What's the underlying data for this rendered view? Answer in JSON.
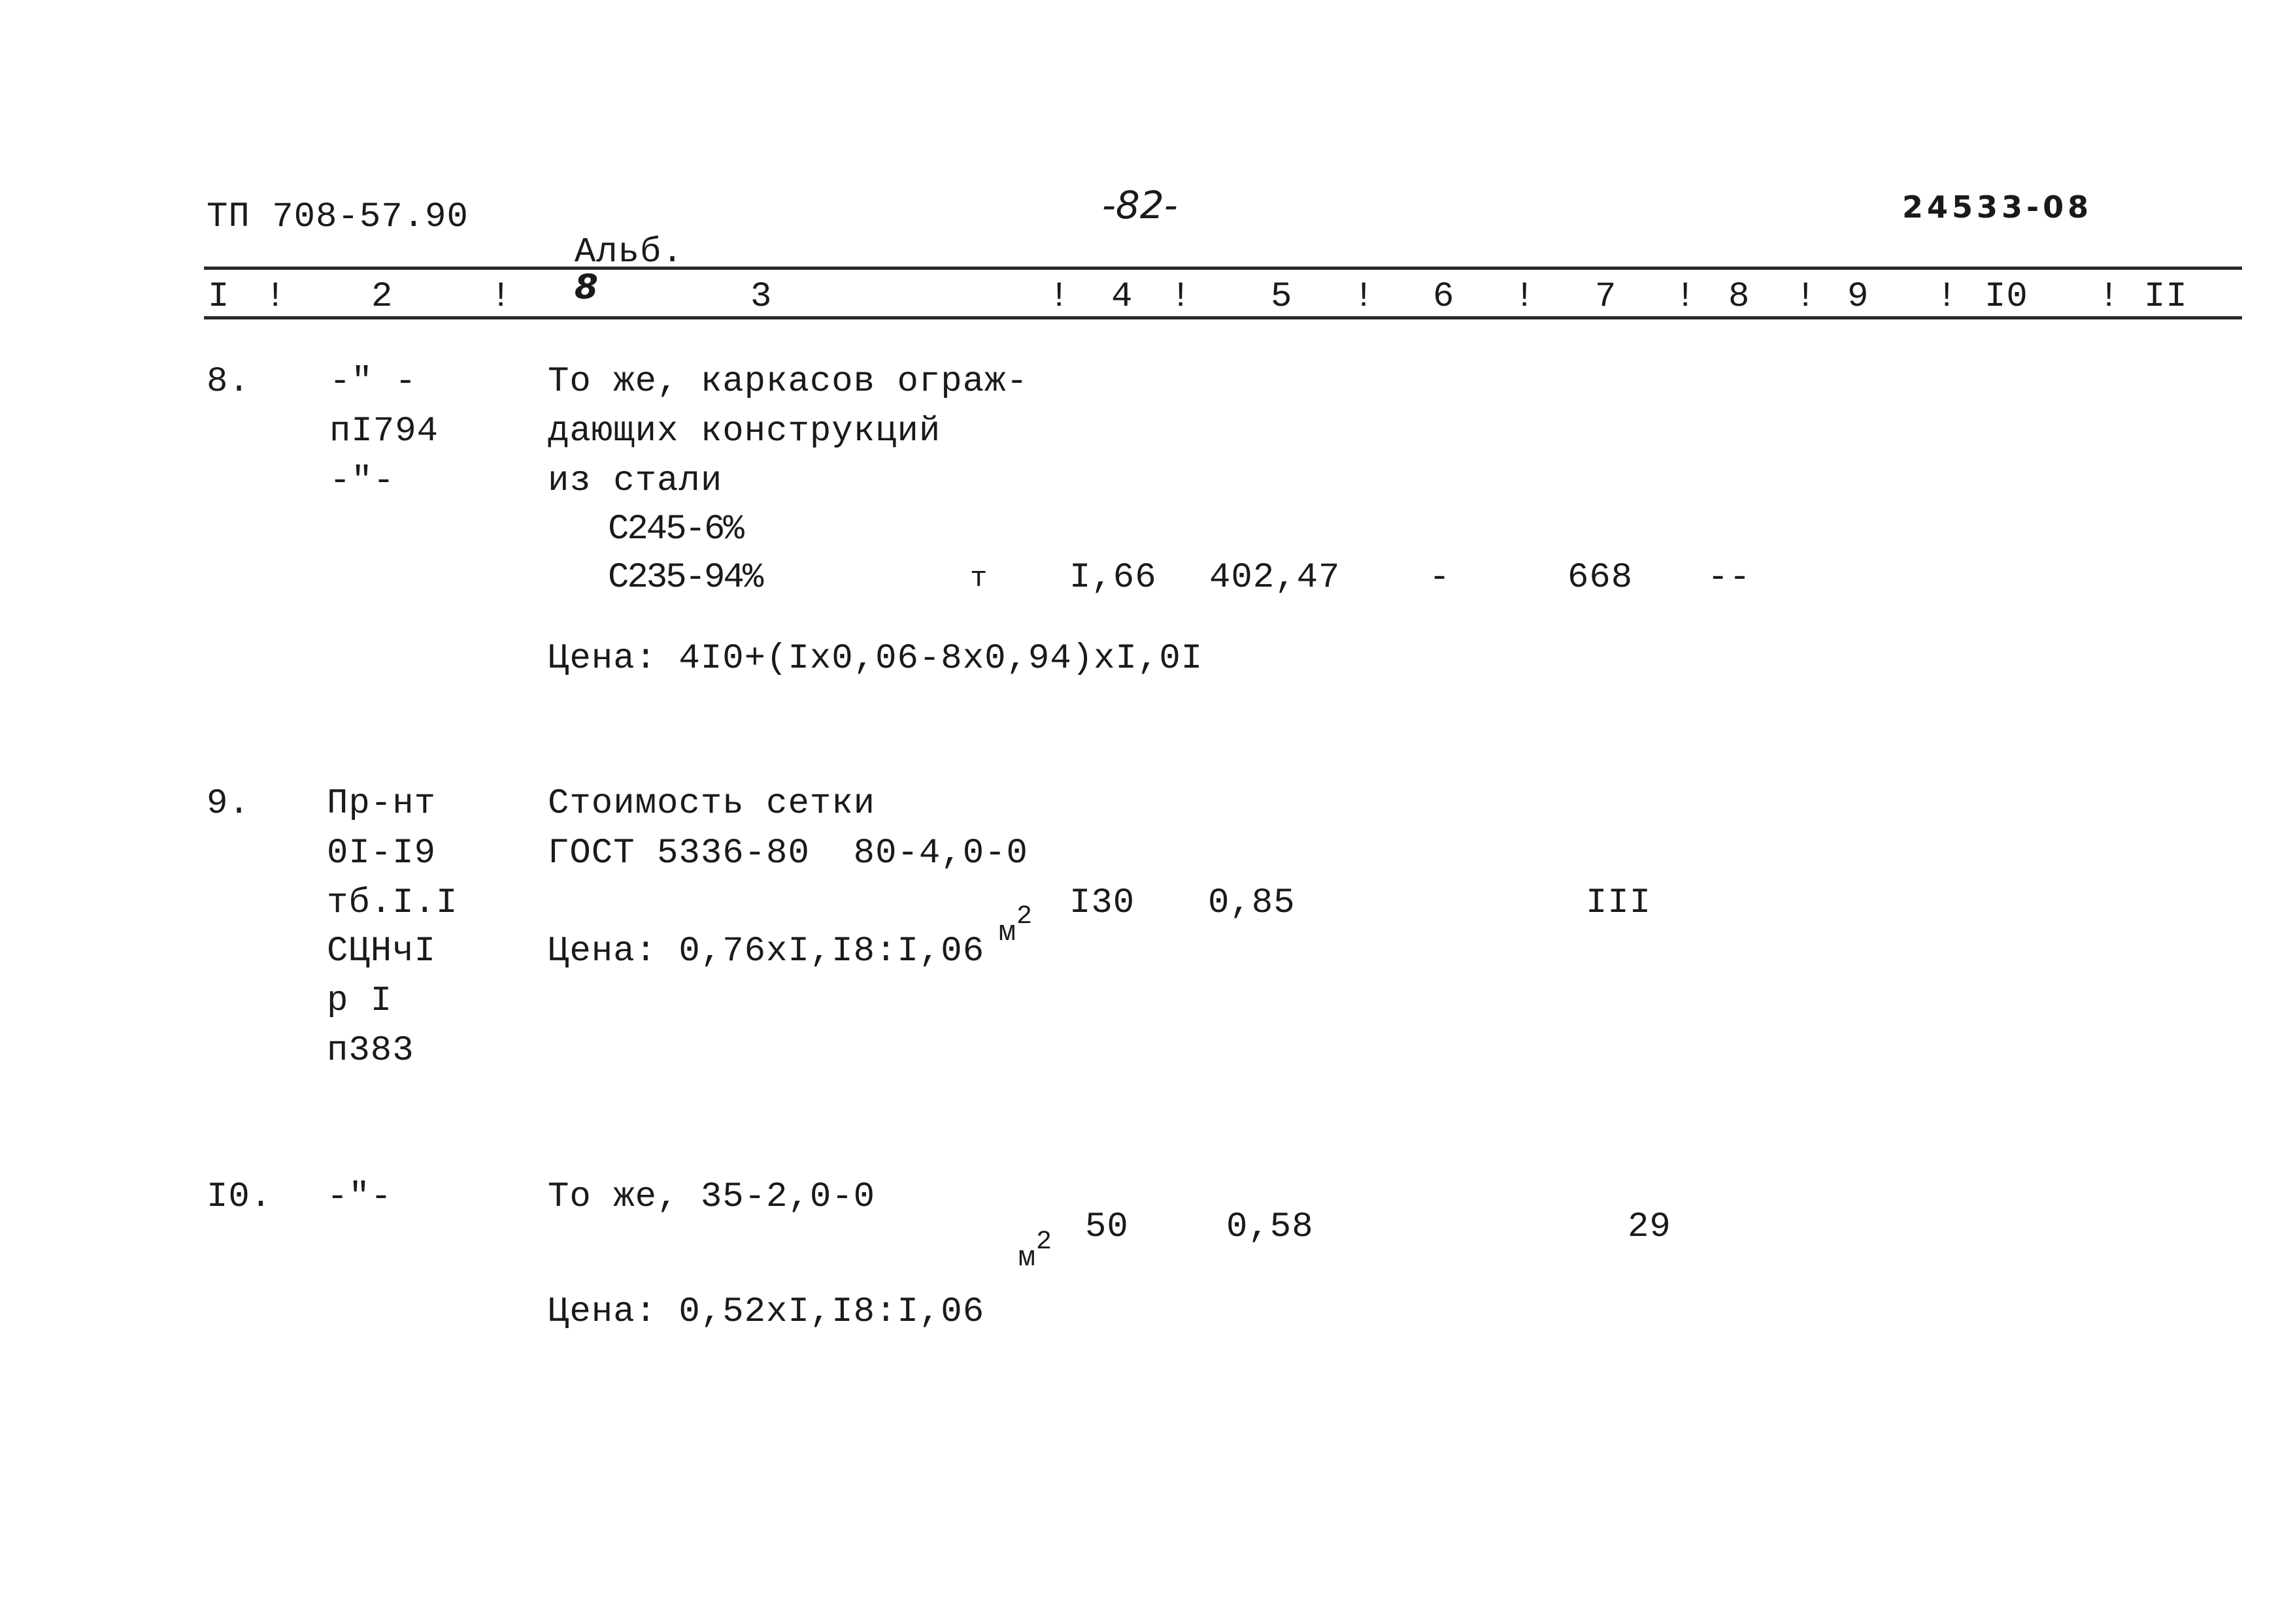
{
  "header": {
    "doc_code": "ТП 708-57.90",
    "album": "Альб.",
    "album_number": "8",
    "page_number": "-82-",
    "stamp": "24533-08"
  },
  "column_header": {
    "columns": [
      "I",
      "2",
      "3",
      "4",
      "5",
      "6",
      "7",
      "8",
      "9",
      "I0",
      "II"
    ],
    "separator": "!"
  },
  "rows": [
    {
      "number": "8.",
      "reference_lines": [
        "-\" -",
        "пI794",
        "-\"-"
      ],
      "description_lines": [
        "То же, каркасов ограж-",
        "дающих конструкций",
        "из стали"
      ],
      "sub_lines": [
        "C245-6%",
        "C235-94%"
      ],
      "unit": "т",
      "quantity": "I,66",
      "price": "402,47",
      "col6": "-",
      "col7": "668",
      "col8": "--",
      "price_formula": "Цена: 4I0+(Ix0,06-8x0,94)xI,0I"
    },
    {
      "number": "9.",
      "reference_lines": [
        "Пр-нт",
        "0I-I9",
        "тб.I.I",
        "СЦНчI",
        "р I",
        "п383"
      ],
      "description_lines": [
        "Стоимость сетки",
        "ГОСТ 5336-80  80-4,0-0"
      ],
      "unit": "м",
      "unit_sup": "2",
      "quantity": "I30",
      "price": "0,85",
      "col7": "III",
      "price_formula": "Цена: 0,76xI,I8:I,06"
    },
    {
      "number": "I0.",
      "reference_lines": [
        "-\"-"
      ],
      "description_lines": [
        "То же, 35-2,0-0"
      ],
      "unit": "м",
      "unit_sup": "2",
      "quantity": "50",
      "price": "0,58",
      "col7": "29",
      "price_formula": "Цена: 0,52xI,I8:I,06"
    }
  ]
}
